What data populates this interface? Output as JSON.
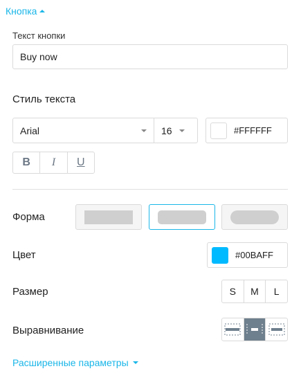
{
  "section": {
    "title": "Кнопка"
  },
  "button_text": {
    "label": "Текст кнопки",
    "value": "Buy now"
  },
  "text_style": {
    "heading": "Стиль текста",
    "font_family": "Arial",
    "font_size": "16",
    "color_value": "#FFFFFF",
    "swatch_color": "#FFFFFF",
    "bold_label": "B",
    "italic_label": "I",
    "underline_label": "U"
  },
  "shape": {
    "label": "Форма",
    "options": [
      "square",
      "rounded",
      "pill"
    ],
    "selected": "rounded"
  },
  "color": {
    "label": "Цвет",
    "value": "#00BAFF",
    "swatch_color": "#00BAFF"
  },
  "size": {
    "label": "Размер",
    "options": [
      "S",
      "M",
      "L"
    ]
  },
  "alignment": {
    "label": "Выравнивание",
    "options": [
      "full-width",
      "center",
      "left-right"
    ],
    "selected": "center"
  },
  "advanced": {
    "label": "Расширенные параметры"
  },
  "colors": {
    "accent": "#19B6E8",
    "border": "#DADADA",
    "active_align": "#6E7F8D"
  }
}
